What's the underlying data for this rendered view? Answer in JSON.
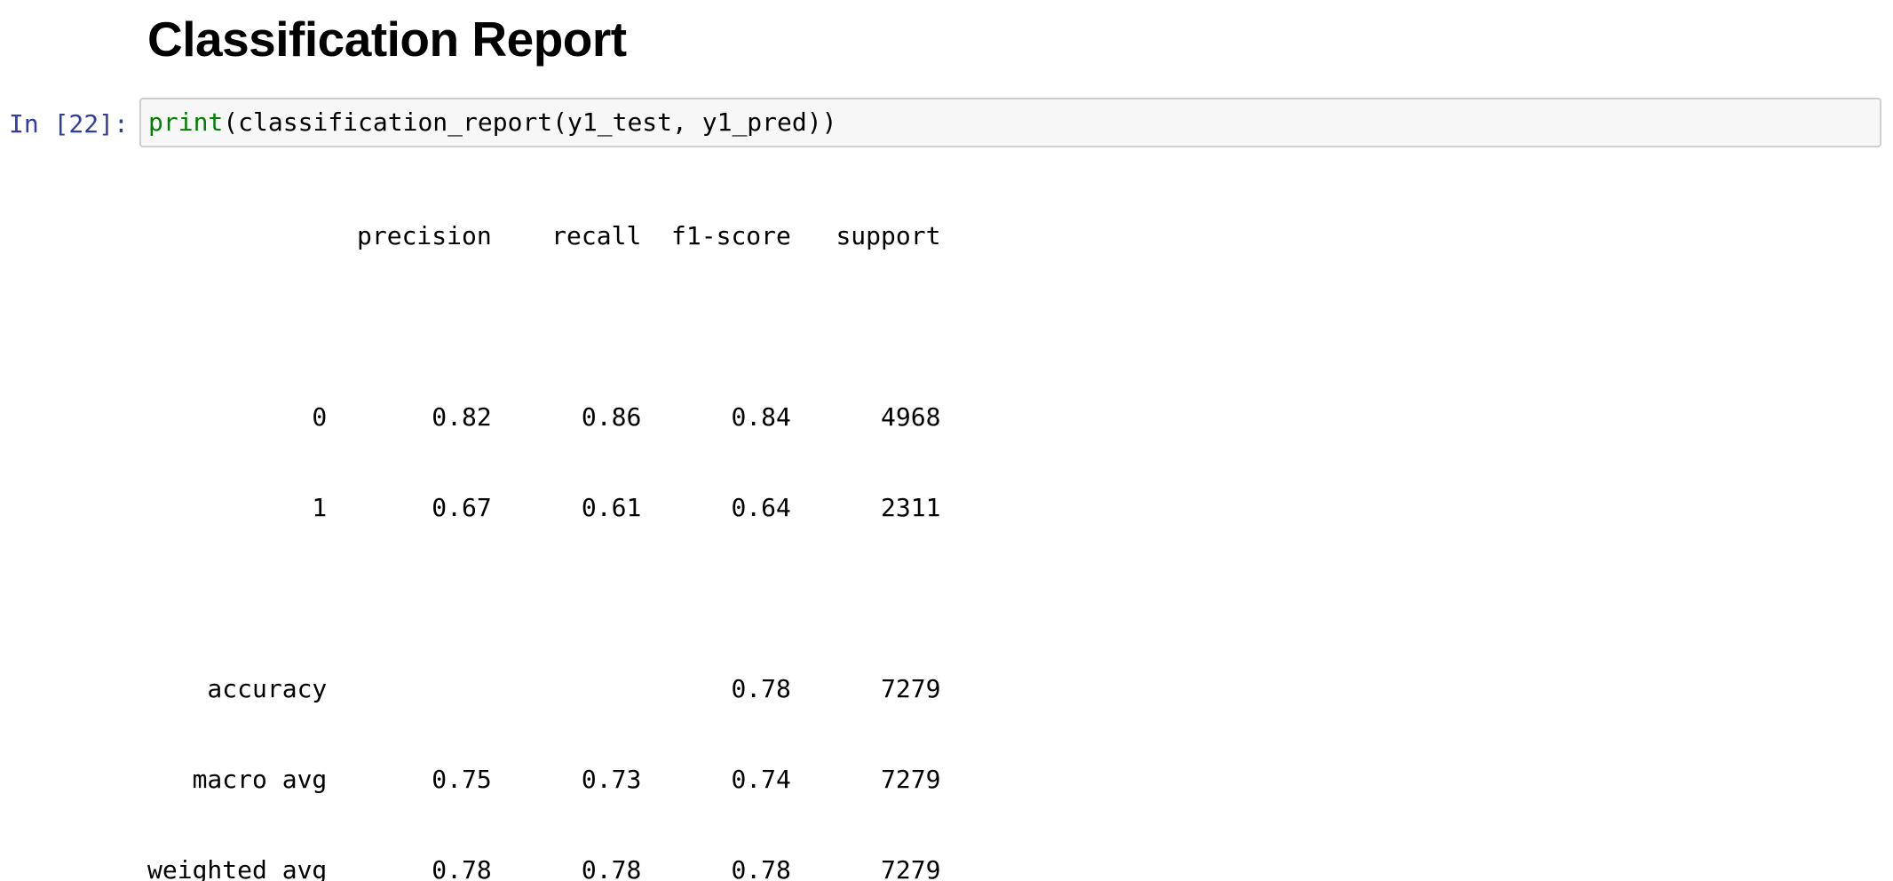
{
  "heading": "Classification Report",
  "cell": {
    "prompt": "In [22]:",
    "code_builtin": "print",
    "code_rest": "(classification_report(y1_test, y1_pred))"
  },
  "output": {
    "lines": [
      "              precision    recall  f1-score   support",
      "",
      "           0       0.82      0.86      0.84      4968",
      "           1       0.67      0.61      0.64      2311",
      "",
      "    accuracy                           0.78      7279",
      "   macro avg       0.75      0.73      0.74      7279",
      "weighted avg       0.78      0.78      0.78      7279"
    ]
  },
  "colors": {
    "prompt": "#303f9f",
    "builtin": "#008000",
    "input_bg": "#f7f7f7",
    "input_border": "#cfcfcf"
  }
}
